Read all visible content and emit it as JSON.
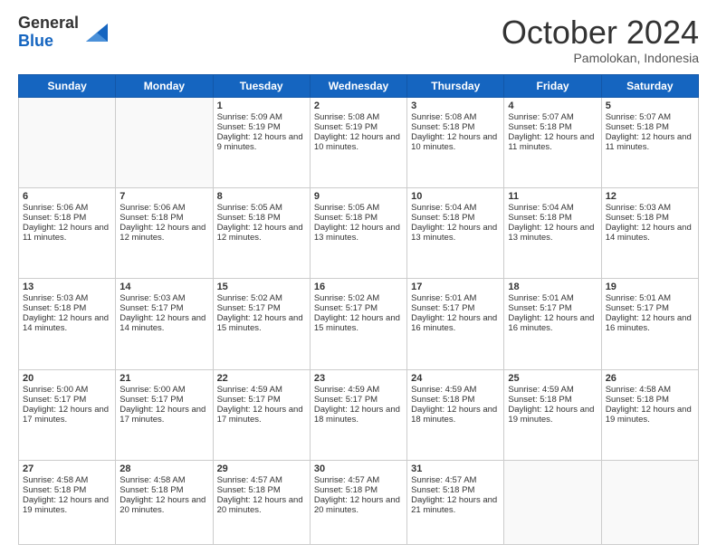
{
  "logo": {
    "general": "General",
    "blue": "Blue"
  },
  "title": {
    "month_year": "October 2024",
    "location": "Pamolokan, Indonesia"
  },
  "weekdays": [
    "Sunday",
    "Monday",
    "Tuesday",
    "Wednesday",
    "Thursday",
    "Friday",
    "Saturday"
  ],
  "weeks": [
    [
      {
        "day": "",
        "info": ""
      },
      {
        "day": "",
        "info": ""
      },
      {
        "day": "1",
        "info": "Sunrise: 5:09 AM\nSunset: 5:19 PM\nDaylight: 12 hours and 9 minutes."
      },
      {
        "day": "2",
        "info": "Sunrise: 5:08 AM\nSunset: 5:19 PM\nDaylight: 12 hours and 10 minutes."
      },
      {
        "day": "3",
        "info": "Sunrise: 5:08 AM\nSunset: 5:18 PM\nDaylight: 12 hours and 10 minutes."
      },
      {
        "day": "4",
        "info": "Sunrise: 5:07 AM\nSunset: 5:18 PM\nDaylight: 12 hours and 11 minutes."
      },
      {
        "day": "5",
        "info": "Sunrise: 5:07 AM\nSunset: 5:18 PM\nDaylight: 12 hours and 11 minutes."
      }
    ],
    [
      {
        "day": "6",
        "info": "Sunrise: 5:06 AM\nSunset: 5:18 PM\nDaylight: 12 hours and 11 minutes."
      },
      {
        "day": "7",
        "info": "Sunrise: 5:06 AM\nSunset: 5:18 PM\nDaylight: 12 hours and 12 minutes."
      },
      {
        "day": "8",
        "info": "Sunrise: 5:05 AM\nSunset: 5:18 PM\nDaylight: 12 hours and 12 minutes."
      },
      {
        "day": "9",
        "info": "Sunrise: 5:05 AM\nSunset: 5:18 PM\nDaylight: 12 hours and 13 minutes."
      },
      {
        "day": "10",
        "info": "Sunrise: 5:04 AM\nSunset: 5:18 PM\nDaylight: 12 hours and 13 minutes."
      },
      {
        "day": "11",
        "info": "Sunrise: 5:04 AM\nSunset: 5:18 PM\nDaylight: 12 hours and 13 minutes."
      },
      {
        "day": "12",
        "info": "Sunrise: 5:03 AM\nSunset: 5:18 PM\nDaylight: 12 hours and 14 minutes."
      }
    ],
    [
      {
        "day": "13",
        "info": "Sunrise: 5:03 AM\nSunset: 5:18 PM\nDaylight: 12 hours and 14 minutes."
      },
      {
        "day": "14",
        "info": "Sunrise: 5:03 AM\nSunset: 5:17 PM\nDaylight: 12 hours and 14 minutes."
      },
      {
        "day": "15",
        "info": "Sunrise: 5:02 AM\nSunset: 5:17 PM\nDaylight: 12 hours and 15 minutes."
      },
      {
        "day": "16",
        "info": "Sunrise: 5:02 AM\nSunset: 5:17 PM\nDaylight: 12 hours and 15 minutes."
      },
      {
        "day": "17",
        "info": "Sunrise: 5:01 AM\nSunset: 5:17 PM\nDaylight: 12 hours and 16 minutes."
      },
      {
        "day": "18",
        "info": "Sunrise: 5:01 AM\nSunset: 5:17 PM\nDaylight: 12 hours and 16 minutes."
      },
      {
        "day": "19",
        "info": "Sunrise: 5:01 AM\nSunset: 5:17 PM\nDaylight: 12 hours and 16 minutes."
      }
    ],
    [
      {
        "day": "20",
        "info": "Sunrise: 5:00 AM\nSunset: 5:17 PM\nDaylight: 12 hours and 17 minutes."
      },
      {
        "day": "21",
        "info": "Sunrise: 5:00 AM\nSunset: 5:17 PM\nDaylight: 12 hours and 17 minutes."
      },
      {
        "day": "22",
        "info": "Sunrise: 4:59 AM\nSunset: 5:17 PM\nDaylight: 12 hours and 17 minutes."
      },
      {
        "day": "23",
        "info": "Sunrise: 4:59 AM\nSunset: 5:17 PM\nDaylight: 12 hours and 18 minutes."
      },
      {
        "day": "24",
        "info": "Sunrise: 4:59 AM\nSunset: 5:18 PM\nDaylight: 12 hours and 18 minutes."
      },
      {
        "day": "25",
        "info": "Sunrise: 4:59 AM\nSunset: 5:18 PM\nDaylight: 12 hours and 19 minutes."
      },
      {
        "day": "26",
        "info": "Sunrise: 4:58 AM\nSunset: 5:18 PM\nDaylight: 12 hours and 19 minutes."
      }
    ],
    [
      {
        "day": "27",
        "info": "Sunrise: 4:58 AM\nSunset: 5:18 PM\nDaylight: 12 hours and 19 minutes."
      },
      {
        "day": "28",
        "info": "Sunrise: 4:58 AM\nSunset: 5:18 PM\nDaylight: 12 hours and 20 minutes."
      },
      {
        "day": "29",
        "info": "Sunrise: 4:57 AM\nSunset: 5:18 PM\nDaylight: 12 hours and 20 minutes."
      },
      {
        "day": "30",
        "info": "Sunrise: 4:57 AM\nSunset: 5:18 PM\nDaylight: 12 hours and 20 minutes."
      },
      {
        "day": "31",
        "info": "Sunrise: 4:57 AM\nSunset: 5:18 PM\nDaylight: 12 hours and 21 minutes."
      },
      {
        "day": "",
        "info": ""
      },
      {
        "day": "",
        "info": ""
      }
    ]
  ]
}
